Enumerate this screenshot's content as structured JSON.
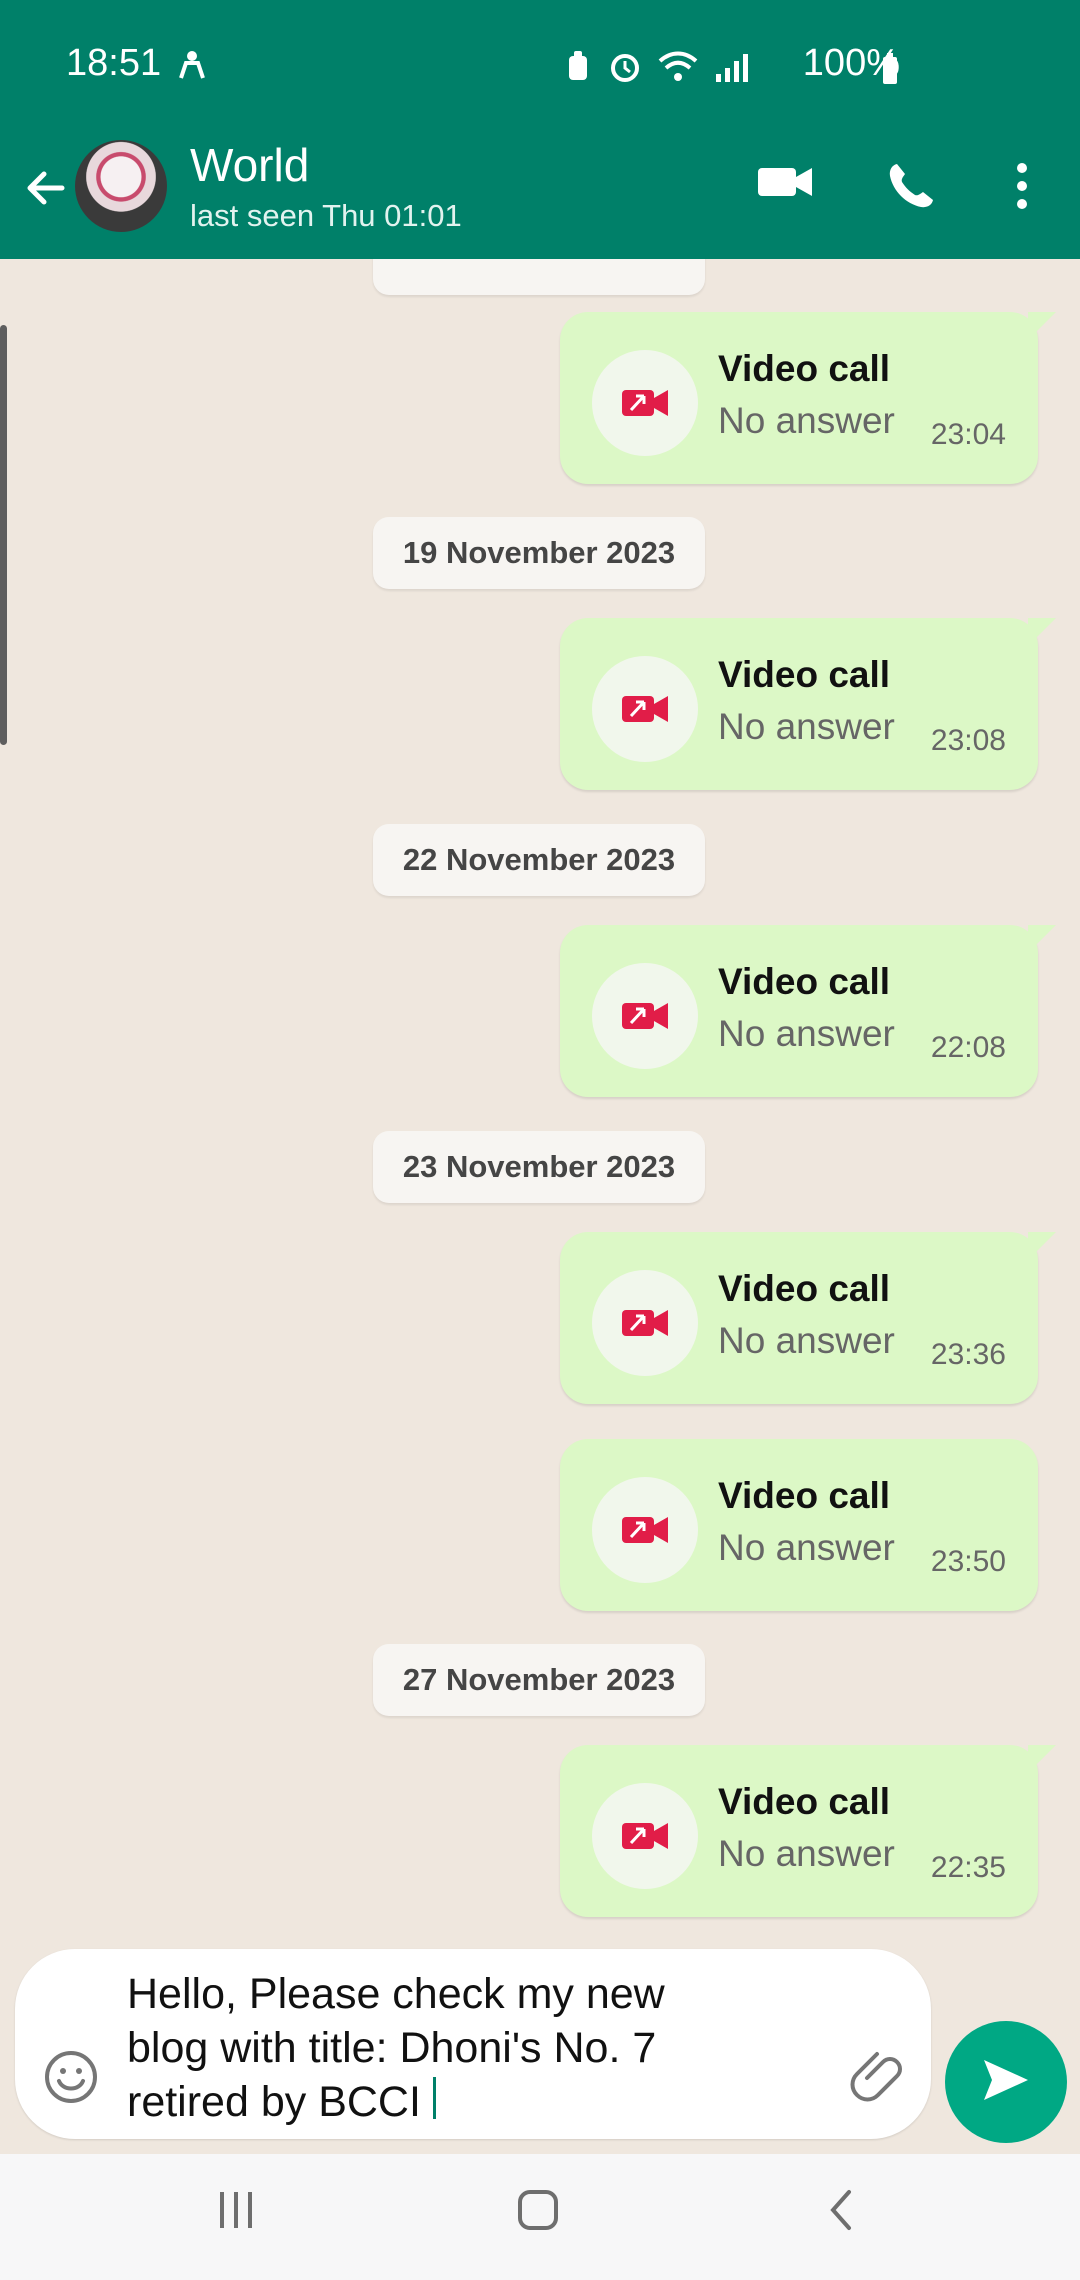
{
  "status_bar": {
    "time": "18:51",
    "battery": "100%"
  },
  "app_bar": {
    "name": "World",
    "status": "last seen Thu 01:01"
  },
  "chat": {
    "items": [
      {
        "type": "call",
        "title": "Video call",
        "subtitle": "No answer",
        "time": "23:04"
      },
      {
        "type": "date",
        "label": "19 November 2023"
      },
      {
        "type": "call",
        "title": "Video call",
        "subtitle": "No answer",
        "time": "23:08"
      },
      {
        "type": "date",
        "label": "22 November 2023"
      },
      {
        "type": "call",
        "title": "Video call",
        "subtitle": "No answer",
        "time": "22:08"
      },
      {
        "type": "date",
        "label": "23 November 2023"
      },
      {
        "type": "call",
        "title": "Video call",
        "subtitle": "No answer",
        "time": "23:36"
      },
      {
        "type": "call",
        "title": "Video call",
        "subtitle": "No answer",
        "time": "23:50"
      },
      {
        "type": "date",
        "label": "27 November 2023"
      },
      {
        "type": "call",
        "title": "Video call",
        "subtitle": "No answer",
        "time": "22:35"
      }
    ]
  },
  "composer": {
    "value": "Hello, Please check my new\nblog with title: Dhoni's No. 7\nretired by BCCI"
  },
  "colors": {
    "header": "#008069",
    "send": "#00a884",
    "missed_call": "#e11d48",
    "bubble": "#dcf8c6"
  },
  "icons": {
    "back": "arrow-left-icon",
    "video": "video-camera-icon",
    "phone": "phone-icon",
    "menu": "more-vertical-icon",
    "missed_video": "missed-video-call-icon",
    "emoji": "emoji-icon",
    "attach": "paperclip-icon",
    "send": "send-icon"
  }
}
